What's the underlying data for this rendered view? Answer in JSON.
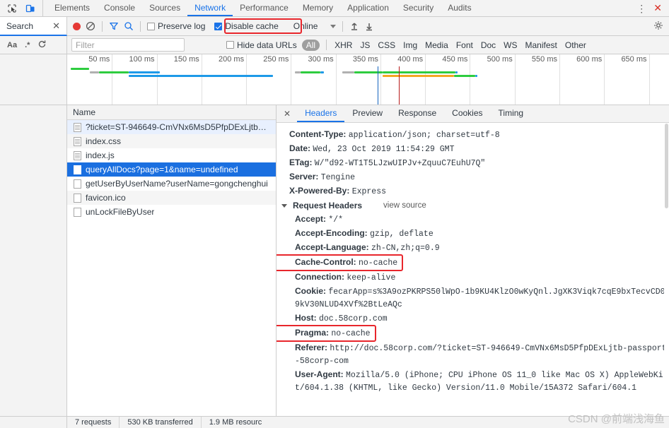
{
  "window": {
    "inspect_icon": "inspect-cursor-icon",
    "device_icon": "device-toggle-icon",
    "more_icon": "more-vertical-icon",
    "close_icon": "close-icon"
  },
  "main_tabs": [
    {
      "label": "Elements",
      "active": false
    },
    {
      "label": "Console",
      "active": false
    },
    {
      "label": "Sources",
      "active": false
    },
    {
      "label": "Network",
      "active": true
    },
    {
      "label": "Performance",
      "active": false
    },
    {
      "label": "Memory",
      "active": false
    },
    {
      "label": "Application",
      "active": false
    },
    {
      "label": "Security",
      "active": false
    },
    {
      "label": "Audits",
      "active": false
    }
  ],
  "search_panel": {
    "tab_label": "Search",
    "close_label": "✕",
    "match_case": "Aa",
    "regex": ".*",
    "refresh_icon": "refresh-icon",
    "clear_icon": "clear-icon"
  },
  "network_toolbar": {
    "record_icon": "record-button",
    "clear_icon": "clear-network-icon",
    "filter_icon": "filter-funnel-icon",
    "search_icon": "search-icon",
    "preserve_log": {
      "label": "Preserve log",
      "checked": false
    },
    "disable_cache": {
      "label": "Disable cache",
      "checked": true,
      "highlighted": true
    },
    "throttle": {
      "value": "Online"
    },
    "import_icon": "import-har-icon",
    "export_icon": "export-har-icon",
    "settings_icon": "gear-icon"
  },
  "filter_bar": {
    "placeholder": "Filter",
    "value": "",
    "hide_data_urls": {
      "label": "Hide data URLs",
      "checked": false
    },
    "types": [
      "All",
      "XHR",
      "JS",
      "CSS",
      "Img",
      "Media",
      "Font",
      "Doc",
      "WS",
      "Manifest",
      "Other"
    ],
    "active_type": "All"
  },
  "overview": {
    "ticks": [
      "50 ms",
      "100 ms",
      "150 ms",
      "200 ms",
      "250 ms",
      "300 ms",
      "350 ms",
      "400 ms",
      "450 ms",
      "500 ms",
      "550 ms",
      "600 ms",
      "650 ms"
    ],
    "dom_content_loaded_color": "#1565c0",
    "load_event_color": "#b71c1c"
  },
  "request_list": {
    "column_header": "Name",
    "rows": [
      {
        "name": "?ticket=ST-946649-CmVNx6MsD5PfpDExLjtb…",
        "type": "doc",
        "state": "hl"
      },
      {
        "name": "index.css",
        "type": "doc",
        "state": "normal"
      },
      {
        "name": "index.js",
        "type": "doc",
        "state": "normal"
      },
      {
        "name": "queryAllDocs?page=1&name=undefined",
        "type": "xhr",
        "state": "sel"
      },
      {
        "name": "getUserByUserName?userName=gongchenghui",
        "type": "xhr",
        "state": "normal"
      },
      {
        "name": "favicon.ico",
        "type": "xhr",
        "state": "normal"
      },
      {
        "name": "unLockFileByUser",
        "type": "xhr",
        "state": "normal"
      }
    ]
  },
  "detail_panel": {
    "close_label": "✕",
    "tabs": [
      {
        "label": "Headers",
        "active": true
      },
      {
        "label": "Preview",
        "active": false
      },
      {
        "label": "Response",
        "active": false
      },
      {
        "label": "Cookies",
        "active": false
      },
      {
        "label": "Timing",
        "active": false
      }
    ],
    "response_headers": [
      {
        "name": "Content-Type:",
        "value": "application/json; charset=utf-8"
      },
      {
        "name": "Date:",
        "value": "Wed, 23 Oct 2019 11:54:29 GMT"
      },
      {
        "name": "ETag:",
        "value": "W/\"d92-WT1T5LJzwUIPJv+ZquuC7EuhU7Q\""
      },
      {
        "name": "Server:",
        "value": "Tengine"
      },
      {
        "name": "X-Powered-By:",
        "value": "Express"
      }
    ],
    "request_headers_section": {
      "title": "Request Headers",
      "view_source": "view source"
    },
    "request_headers": [
      {
        "name": "Accept:",
        "value": "*/*",
        "boxed": false
      },
      {
        "name": "Accept-Encoding:",
        "value": "gzip, deflate",
        "boxed": false
      },
      {
        "name": "Accept-Language:",
        "value": "zh-CN,zh;q=0.9",
        "boxed": false
      },
      {
        "name": "Cache-Control:",
        "value": "no-cache",
        "boxed": true
      },
      {
        "name": "Connection:",
        "value": "keep-alive",
        "boxed": false
      },
      {
        "name": "Cookie:",
        "value": "fecarApp=s%3A9ozPKRPS50lWpO-1b9KU4KlzO0wKyQnl.JgXK3Viqk7cqE9bxTecvCD09kV30NLUD4XVf%2BtLeAQc",
        "boxed": false
      },
      {
        "name": "Host:",
        "value": "doc.58corp.com",
        "boxed": false
      },
      {
        "name": "Pragma:",
        "value": "no-cache",
        "boxed": true
      },
      {
        "name": "Referer:",
        "value": "http://doc.58corp.com/?ticket=ST-946649-CmVNx6MsD5PfpDExLjtb-passport-58corp-com",
        "boxed": false
      },
      {
        "name": "User-Agent:",
        "value": "Mozilla/5.0 (iPhone; CPU iPhone OS 11_0 like Mac OS X) AppleWebKit/604.1.38 (KHTML, like Gecko) Version/11.0 Mobile/15A372 Safari/604.1",
        "boxed": false
      }
    ]
  },
  "status_bar": {
    "requests": "7 requests",
    "transferred": "530 KB transferred",
    "resources": "1.9 MB resourc"
  },
  "watermark": "CSDN @前端浅海鱼",
  "colors": {
    "accent": "#1a73e8",
    "annotation_red": "#e8262c",
    "selection_blue": "#1a6fe0",
    "record_red": "#e53935",
    "bar_green": "#2ecc3f",
    "bar_blue": "#1e9ae8",
    "bar_orange": "#f5a623",
    "bar_gray": "#b0b0b0"
  }
}
